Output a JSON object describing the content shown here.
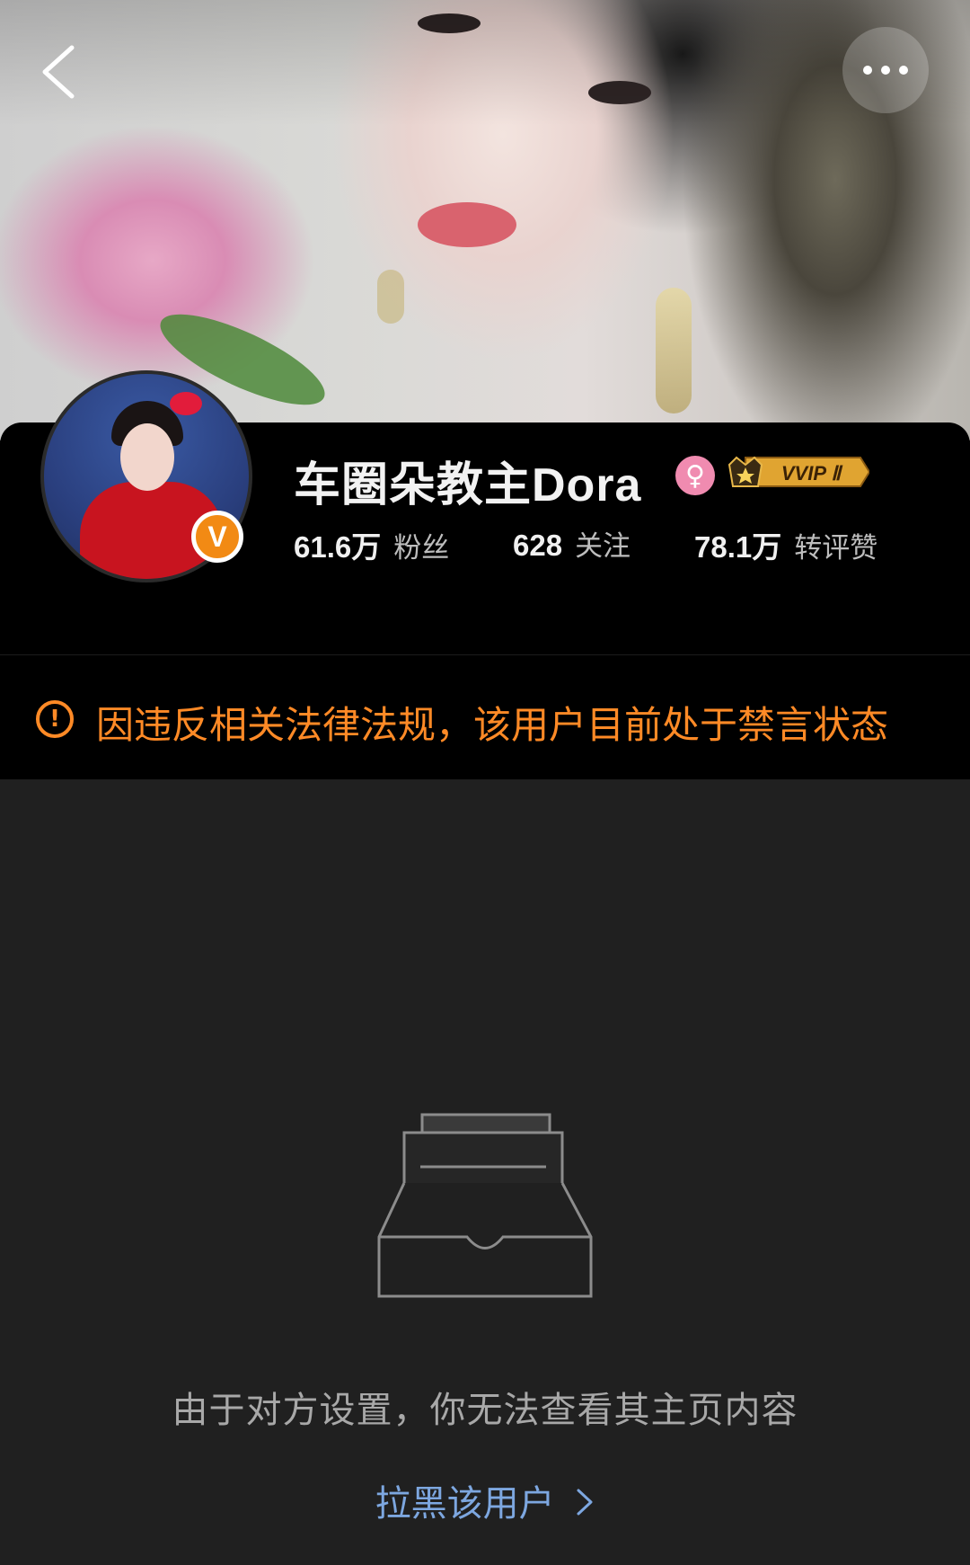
{
  "header": {
    "back_icon": "chevron-left-icon",
    "more_icon": "more-horizontal-icon"
  },
  "profile": {
    "name": "车圈朵教主Dora",
    "verified_badge": "V",
    "gender_icon": "female-icon",
    "vip_label": "VVIP Ⅱ",
    "stats": [
      {
        "num": "61.6万",
        "label": "粉丝"
      },
      {
        "num": "628",
        "label": "关注"
      },
      {
        "num": "78.1万",
        "label": "转评赞"
      }
    ]
  },
  "notice": {
    "icon": "!",
    "text": "因违反相关法律法规，该用户目前处于禁言状态"
  },
  "empty_state": {
    "icon": "empty-box-icon",
    "message": "由于对方设置，你无法查看其主页内容",
    "link": "拉黑该用户"
  },
  "colors": {
    "background": "#202020",
    "warning": "#ff8a26",
    "link": "#7da7e0",
    "verified": "#f28a14",
    "gender": "#f08bb0"
  }
}
